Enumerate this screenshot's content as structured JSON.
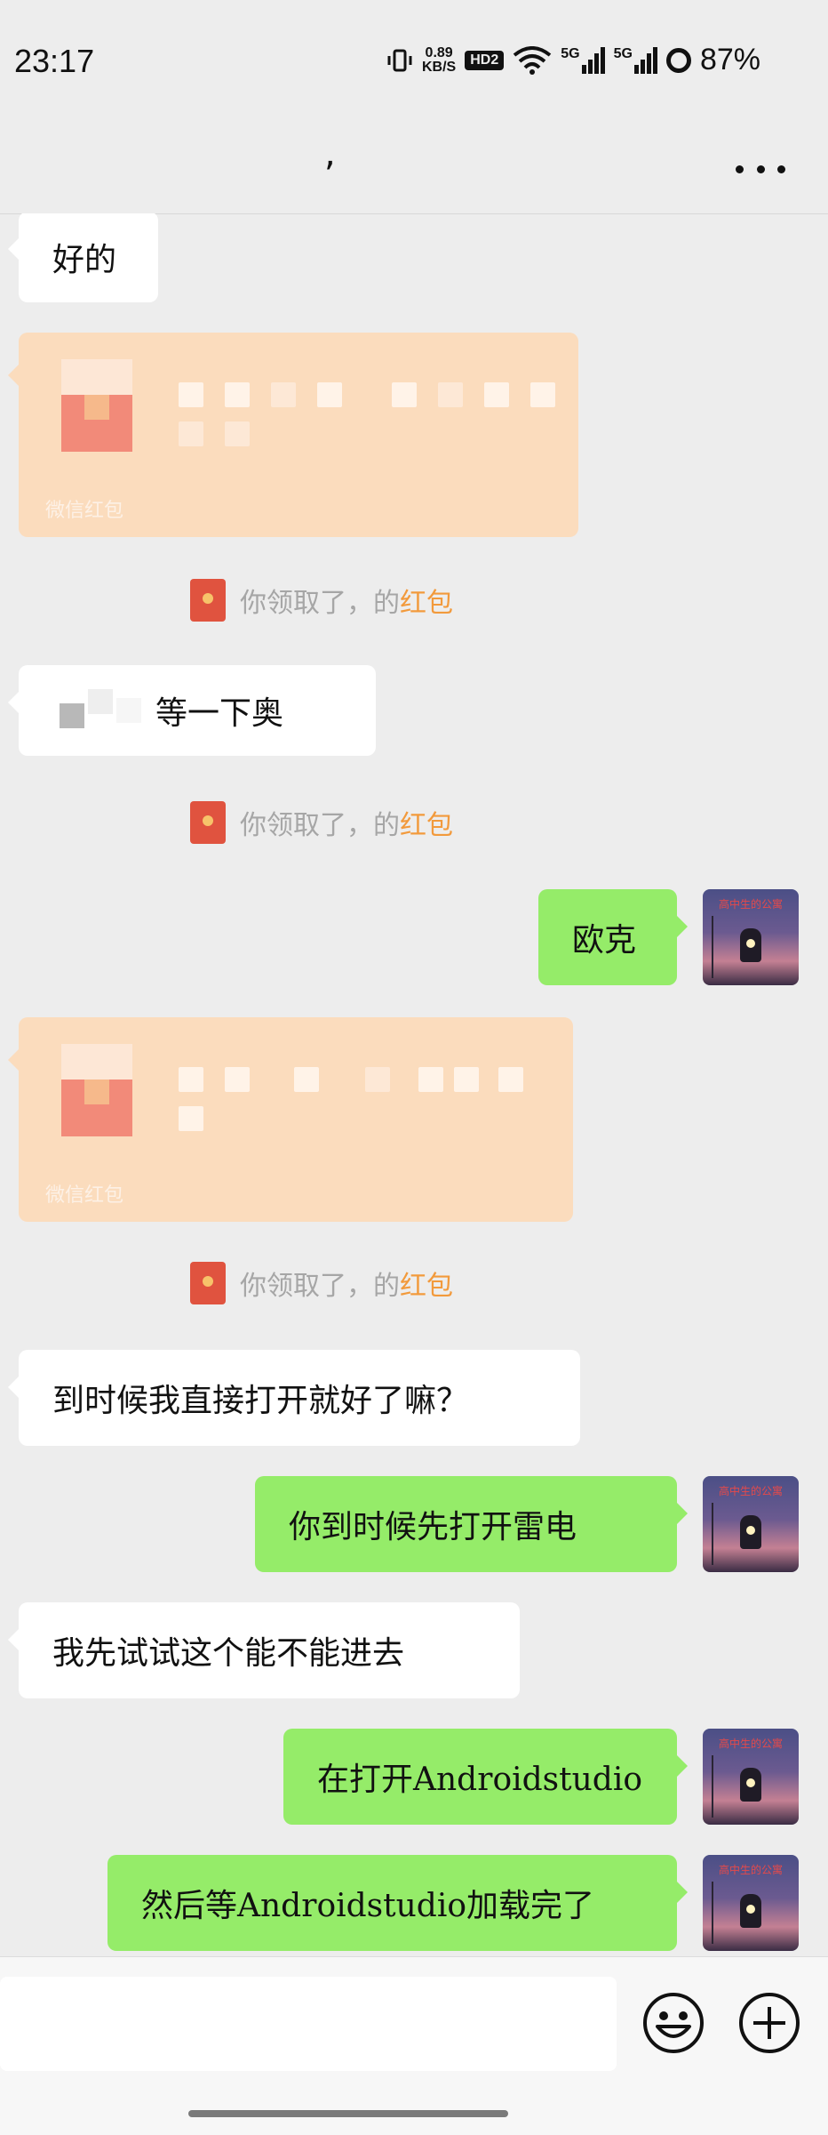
{
  "status_bar": {
    "time": "23:17",
    "net_speed_value": "0.89",
    "net_speed_unit": "KB/S",
    "hd_badge": "HD2",
    "signal_1": "5G",
    "signal_2": "5G",
    "battery": "87%"
  },
  "header": {
    "title": ",",
    "more_icon": "more-dots-icon"
  },
  "messages": {
    "m1": {
      "side": "left",
      "text": "好的"
    },
    "rp1": {
      "label": "微信红包"
    },
    "n1": {
      "prefix": "你领取了，的",
      "link": "红包"
    },
    "m2": {
      "side": "left",
      "text": "等一下奥"
    },
    "n2": {
      "prefix": "你领取了，的",
      "link": "红包"
    },
    "m3": {
      "side": "right",
      "text": "欧克"
    },
    "rp2": {
      "label": "微信红包"
    },
    "n3": {
      "prefix": "你领取了，的",
      "link": "红包"
    },
    "m4": {
      "side": "left",
      "text": "到时候我直接打开就好了嘛？"
    },
    "m5": {
      "side": "right",
      "text": "你到时候先打开雷电"
    },
    "m6": {
      "side": "left",
      "text": "我先试试这个能不能进去"
    },
    "m7": {
      "side": "right",
      "text": "在打开Androidstudio"
    },
    "m8": {
      "side": "right",
      "text": "然后等Androidstudio加载完了"
    }
  },
  "avatar": {
    "caption": "高中生的公寓"
  },
  "input_bar": {
    "emoji_icon": "emoji-smile-icon",
    "plus_icon": "plus-circle-icon"
  },
  "colors": {
    "background": "#ededed",
    "bubble_right": "#95ec69",
    "bubble_left": "#ffffff",
    "red_packet": "#fbdcbd",
    "link": "#f29a3c"
  }
}
